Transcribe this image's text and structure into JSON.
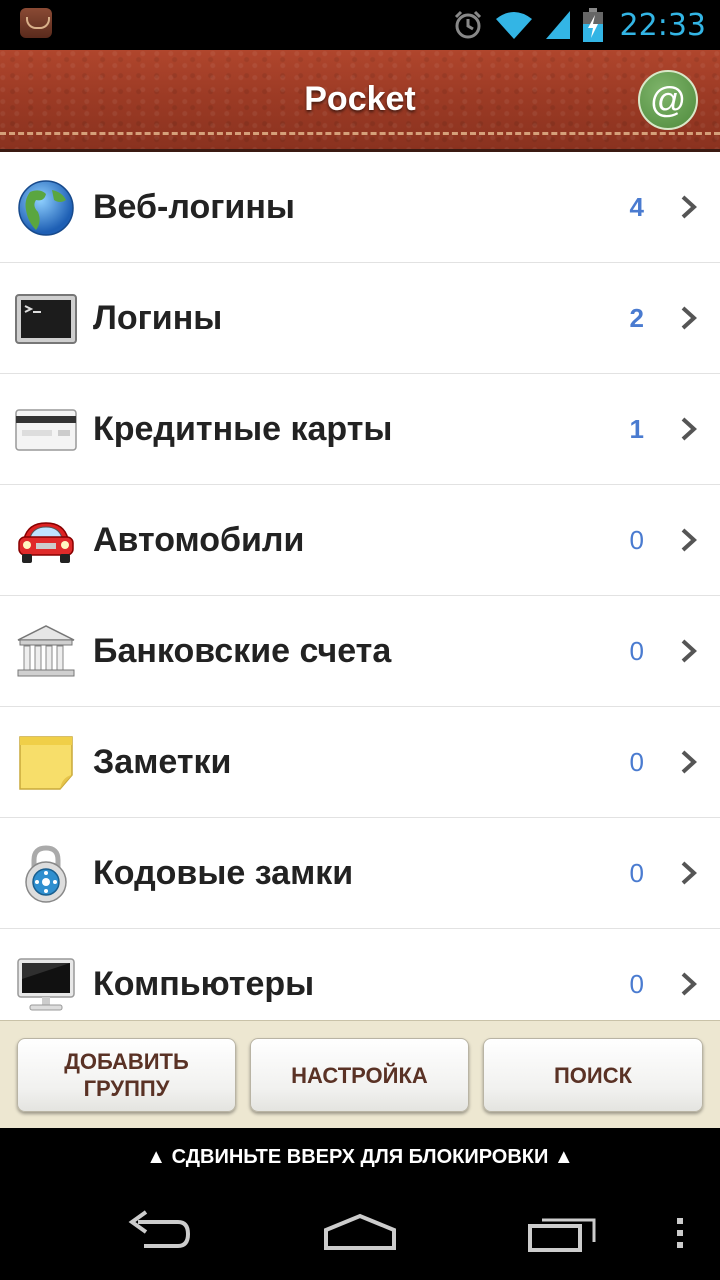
{
  "status_bar": {
    "time": "22:33",
    "icons": [
      "app-notification-icon",
      "alarm-icon",
      "wifi-icon",
      "signal-icon",
      "battery-charging-icon"
    ]
  },
  "header": {
    "title": "Pocket",
    "action_icon": "@"
  },
  "groups": [
    {
      "label": "Веб-логины",
      "count": "4",
      "icon": "globe-icon"
    },
    {
      "label": "Логины",
      "count": "2",
      "icon": "terminal-icon"
    },
    {
      "label": "Кредитные карты",
      "count": "1",
      "icon": "credit-card-icon"
    },
    {
      "label": "Автомобили",
      "count": "0",
      "icon": "car-icon"
    },
    {
      "label": "Банковские счета",
      "count": "0",
      "icon": "bank-icon"
    },
    {
      "label": "Заметки",
      "count": "0",
      "icon": "sticky-note-icon"
    },
    {
      "label": "Кодовые замки",
      "count": "0",
      "icon": "combination-lock-icon"
    },
    {
      "label": "Компьютеры",
      "count": "0",
      "icon": "computer-monitor-icon"
    }
  ],
  "buttons": {
    "add_group_line1": "ДОБАВИТЬ",
    "add_group_line2": "ГРУППУ",
    "settings": "НАСТРОЙКА",
    "search": "ПОИСК"
  },
  "lock_hint": "▲ СДВИНЬТЕ ВВЕРХ ДЛЯ БЛОКИРОВКИ ▲",
  "colors": {
    "accent": "#33b5e5",
    "count": "#4a7bd0",
    "leather": "#9d3b25",
    "button_text": "#5a3225"
  }
}
